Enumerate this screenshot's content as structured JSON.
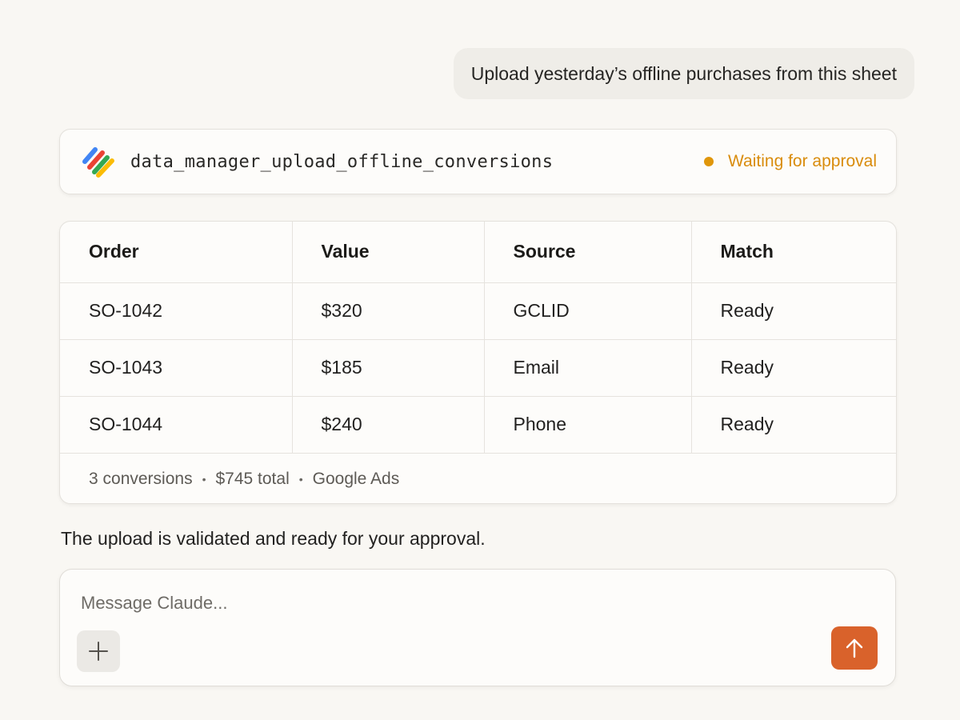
{
  "conversation": {
    "user_message": "Upload yesterday’s offline purchases from this sheet",
    "assistant_reply": "The upload is validated and ready for your approval."
  },
  "tool_call": {
    "icon": "google-ads-logo-icon",
    "name": "data_manager_upload_offline_conversions",
    "status": "Waiting for approval",
    "status_color": "#e0960a"
  },
  "table": {
    "headers": {
      "order": "Order",
      "value": "Value",
      "source": "Source",
      "match": "Match"
    },
    "rows": [
      {
        "order": "SO-1042",
        "value": "$320",
        "source": "GCLID",
        "match": "Ready"
      },
      {
        "order": "SO-1043",
        "value": "$185",
        "source": "Email",
        "match": "Ready"
      },
      {
        "order": "SO-1044",
        "value": "$240",
        "source": "Phone",
        "match": "Ready"
      }
    ],
    "summary": {
      "count": "3 conversions",
      "total": "$745 total",
      "destination": "Google Ads",
      "separator": "•"
    }
  },
  "composer": {
    "placeholder": "Message Claude...",
    "add_icon": "plus-icon",
    "send_icon": "arrow-up-icon",
    "send_color": "#d9622b"
  }
}
